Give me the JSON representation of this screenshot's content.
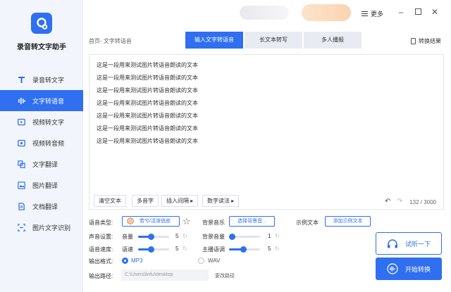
{
  "app": {
    "name": "录音转文字助手"
  },
  "sidebar": {
    "items": [
      {
        "label": "录音转文字"
      },
      {
        "label": "文字转语音"
      },
      {
        "label": "视频转文字"
      },
      {
        "label": "视频转音频"
      },
      {
        "label": "文字翻译"
      },
      {
        "label": "图片翻译"
      },
      {
        "label": "文档翻译"
      },
      {
        "label": "图片文字识别"
      }
    ]
  },
  "titlebar": {
    "more_label": "更多"
  },
  "header": {
    "breadcrumb": "首页- 文字转语音",
    "tabs": [
      {
        "label": "输入文字转语音"
      },
      {
        "label": "长文本转写"
      },
      {
        "label": "多人播报"
      }
    ],
    "result_label": "转换结果"
  },
  "editor": {
    "lines": [
      "这是一段用来测试图片转语音朗读的文本",
      "这是一段用来测试图片转语音朗读的文本",
      "这是一段用来测试图片转语音朗读的文本",
      "这是一段用来测试图片转语音朗读的文本",
      "这是一段用来测试图片转语音朗读的文本",
      "这是一段用来测试图片转语音朗读的文本",
      "这是一段用来测试图片转语音朗读的文本"
    ],
    "clear_label": "清空文本",
    "polyphone_label": "多音字",
    "pause_label": "插入间隔",
    "digit_label": "数字读法",
    "char_count": "132 / 3000"
  },
  "settings": {
    "voice_type_label": "语音类型:",
    "voice_name": "若兮/活泼俏皮",
    "bg_music_label": "背景音乐",
    "bg_music_button": "选择背景音...",
    "sample_label": "示例文本",
    "sample_button": "添加示例文本",
    "sound_label": "声音设置:",
    "volume_label": "音量",
    "volume_value": "5",
    "bg_volume_label": "背景音量",
    "bg_volume_value": "1",
    "speed_label": "语音速度:",
    "speed_sub_label": "语速",
    "speed_value": "5",
    "pitch_label": "主播语调",
    "pitch_value": "5",
    "format_label": "输出格式:",
    "format_mp3": "MP3",
    "format_wav": "WAV",
    "path_label": "输出路径:",
    "path_value": "C:\\Users\\linfu\\desktop",
    "change_path_label": "更改路径"
  },
  "actions": {
    "listen_label": "试听一下",
    "convert_label": "开始转换"
  },
  "colors": {
    "accent": "#2f6ff0"
  }
}
